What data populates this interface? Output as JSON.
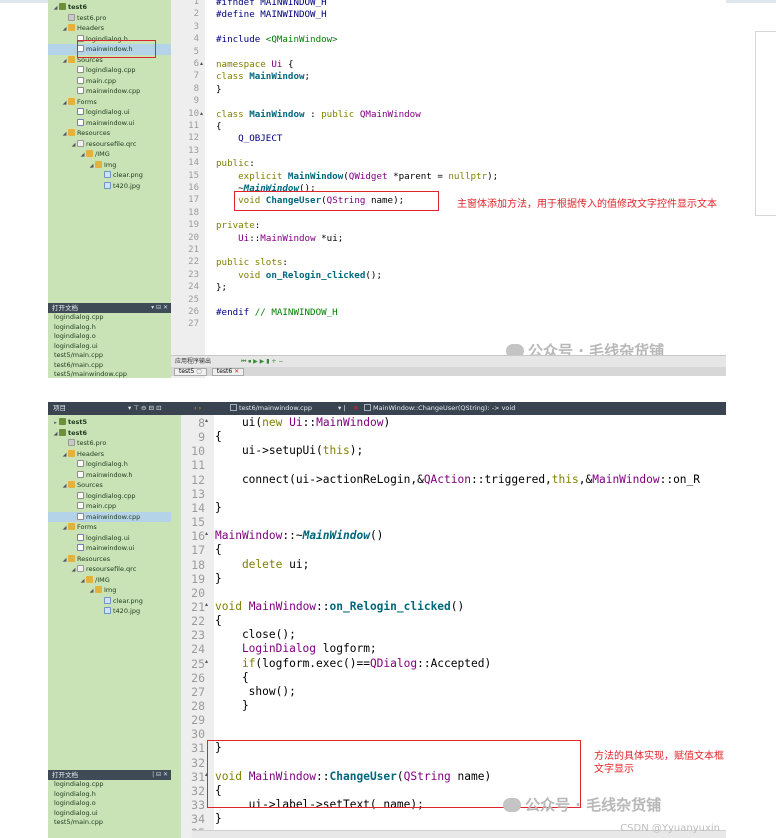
{
  "top": {
    "tree": [
      {
        "label": "test6",
        "indent": 0,
        "twisty": "◢",
        "icon": "proj",
        "selected": false,
        "bold": true
      },
      {
        "label": "test6.pro",
        "indent": 1,
        "twisty": "",
        "icon": "pro",
        "selected": false,
        "bold": false
      },
      {
        "label": "Headers",
        "indent": 1,
        "twisty": "◢",
        "icon": "folder",
        "selected": false,
        "bold": false
      },
      {
        "label": "logindialog.h",
        "indent": 2,
        "twisty": "",
        "icon": "file",
        "selected": false,
        "bold": false
      },
      {
        "label": "mainwindow.h",
        "indent": 2,
        "twisty": "",
        "icon": "file",
        "selected": true,
        "bold": false
      },
      {
        "label": "Sources",
        "indent": 1,
        "twisty": "◢",
        "icon": "folder",
        "selected": false,
        "bold": false
      },
      {
        "label": "logindialog.cpp",
        "indent": 2,
        "twisty": "",
        "icon": "file",
        "selected": false,
        "bold": false
      },
      {
        "label": "main.cpp",
        "indent": 2,
        "twisty": "",
        "icon": "file",
        "selected": false,
        "bold": false
      },
      {
        "label": "mainwindow.cpp",
        "indent": 2,
        "twisty": "",
        "icon": "file",
        "selected": false,
        "bold": false
      },
      {
        "label": "Forms",
        "indent": 1,
        "twisty": "◢",
        "icon": "folder",
        "selected": false,
        "bold": false
      },
      {
        "label": "logindialog.ui",
        "indent": 2,
        "twisty": "",
        "icon": "ui",
        "selected": false,
        "bold": false
      },
      {
        "label": "mainwindow.ui",
        "indent": 2,
        "twisty": "",
        "icon": "ui",
        "selected": false,
        "bold": false
      },
      {
        "label": "Resources",
        "indent": 1,
        "twisty": "◢",
        "icon": "folder",
        "selected": false,
        "bold": false
      },
      {
        "label": "resoursefile.qrc",
        "indent": 2,
        "twisty": "◢",
        "icon": "qrc",
        "selected": false,
        "bold": false
      },
      {
        "label": "/IMG",
        "indent": 3,
        "twisty": "◢",
        "icon": "folder",
        "selected": false,
        "bold": false
      },
      {
        "label": "Img",
        "indent": 4,
        "twisty": "◢",
        "icon": "folder",
        "selected": false,
        "bold": false
      },
      {
        "label": "clear.png",
        "indent": 5,
        "twisty": "",
        "icon": "img",
        "selected": false,
        "bold": false
      },
      {
        "label": "t420.jpg",
        "indent": 5,
        "twisty": "",
        "icon": "img",
        "selected": false,
        "bold": false
      }
    ],
    "open_docs_title": "打开文档",
    "open_docs": [
      "logindialog.cpp",
      "logindialog.h",
      "logindialog.o",
      "logindialog.ui",
      "test5/main.cpp",
      "test6/main.cpp",
      "test5/mainwindow.cpp"
    ],
    "code": [
      {
        "n": "1",
        "fold": "",
        "parts": [
          [
            "c-pp",
            "#ifndef MAINWINDOW_H"
          ]
        ]
      },
      {
        "n": "2",
        "fold": "",
        "parts": [
          [
            "c-pp",
            "#define MAINWINDOW_H"
          ]
        ]
      },
      {
        "n": "3",
        "fold": "",
        "parts": []
      },
      {
        "n": "4",
        "fold": "",
        "parts": [
          [
            "c-pp",
            "#include "
          ],
          [
            "c-str",
            "<QMainWindow>"
          ]
        ]
      },
      {
        "n": "5",
        "fold": "",
        "parts": []
      },
      {
        "n": "6",
        "fold": "▴",
        "parts": [
          [
            "c-kw",
            "namespace "
          ],
          [
            "c-type",
            "Ui"
          ],
          [
            "c-def",
            " {"
          ]
        ]
      },
      {
        "n": "7",
        "fold": "",
        "parts": [
          [
            "c-kw",
            "class "
          ],
          [
            "c-fn",
            "MainWindow"
          ],
          [
            "c-def",
            ";"
          ]
        ]
      },
      {
        "n": "8",
        "fold": "",
        "parts": [
          [
            "c-def",
            "}"
          ]
        ]
      },
      {
        "n": "9",
        "fold": "",
        "parts": []
      },
      {
        "n": "10",
        "fold": "▴",
        "parts": [
          [
            "c-kw",
            "class "
          ],
          [
            "c-fn",
            "MainWindow"
          ],
          [
            "c-def",
            " : "
          ],
          [
            "c-kw",
            "public "
          ],
          [
            "c-type",
            "QMainWindow"
          ]
        ]
      },
      {
        "n": "11",
        "fold": "",
        "parts": [
          [
            "c-def",
            "{"
          ]
        ]
      },
      {
        "n": "12",
        "fold": "",
        "parts": [
          [
            "c-pp",
            "    Q_OBJECT"
          ]
        ]
      },
      {
        "n": "13",
        "fold": "",
        "parts": []
      },
      {
        "n": "14",
        "fold": "",
        "parts": [
          [
            "c-kw",
            "public"
          ],
          [
            "c-def",
            ":"
          ]
        ]
      },
      {
        "n": "15",
        "fold": "",
        "parts": [
          [
            "c-kw",
            "    explicit "
          ],
          [
            "c-fn",
            "MainWindow"
          ],
          [
            "c-def",
            "("
          ],
          [
            "c-type",
            "QWidget"
          ],
          [
            "c-def",
            " *parent = "
          ],
          [
            "c-kw",
            "nullptr"
          ],
          [
            "c-def",
            ");"
          ]
        ]
      },
      {
        "n": "16",
        "fold": "",
        "parts": [
          [
            "c-def",
            "    ~"
          ],
          [
            "c-fni",
            "MainWindow"
          ],
          [
            "c-def",
            "();"
          ]
        ]
      },
      {
        "n": "17",
        "fold": "",
        "parts": [
          [
            "c-kw",
            "    void "
          ],
          [
            "c-fn",
            "ChangeUser"
          ],
          [
            "c-def",
            "("
          ],
          [
            "c-type",
            "QString"
          ],
          [
            "c-def",
            " name);"
          ]
        ]
      },
      {
        "n": "18",
        "fold": "",
        "parts": []
      },
      {
        "n": "19",
        "fold": "",
        "parts": [
          [
            "c-kw",
            "private"
          ],
          [
            "c-def",
            ":"
          ]
        ]
      },
      {
        "n": "20",
        "fold": "",
        "parts": [
          [
            "c-type",
            "    Ui"
          ],
          [
            "c-def",
            "::"
          ],
          [
            "c-type",
            "MainWindow"
          ],
          [
            "c-def",
            " *ui;"
          ]
        ]
      },
      {
        "n": "21",
        "fold": "",
        "parts": []
      },
      {
        "n": "22",
        "fold": "",
        "parts": [
          [
            "c-kw",
            "public slots"
          ],
          [
            "c-def",
            ":"
          ]
        ]
      },
      {
        "n": "23",
        "fold": "",
        "parts": [
          [
            "c-kw",
            "    void "
          ],
          [
            "c-fn",
            "on_Relogin_clicked"
          ],
          [
            "c-def",
            "();"
          ]
        ]
      },
      {
        "n": "24",
        "fold": "",
        "parts": [
          [
            "c-def",
            "};"
          ]
        ]
      },
      {
        "n": "25",
        "fold": "",
        "parts": []
      },
      {
        "n": "26",
        "fold": "",
        "parts": [
          [
            "c-pp",
            "#endif "
          ],
          [
            "c-str",
            "// MAINWINDOW_H"
          ]
        ]
      },
      {
        "n": "27",
        "fold": "",
        "parts": []
      }
    ],
    "annotation": "主窗体添加方法，用于根据传入的值修改文字控件显示文本",
    "watermark": "公众号 · 毛线杂货铺",
    "bottom_bar": "应用程序输出",
    "bottom_controls": "⏮ ⏹ ▶ ▶ ▮ + −",
    "tabs": [
      "test5",
      "test6"
    ]
  },
  "bottom": {
    "toolbar": {
      "project_label": "项目",
      "file_path": "test6/mainwindow.cpp",
      "function_label": "MainWindow::ChangeUser(QString): -> void"
    },
    "tree": [
      {
        "label": "test5",
        "indent": 0,
        "twisty": "▸",
        "icon": "proj",
        "selected": false,
        "bold": true
      },
      {
        "label": "test6",
        "indent": 0,
        "twisty": "◢",
        "icon": "proj",
        "selected": false,
        "bold": true
      },
      {
        "label": "test6.pro",
        "indent": 1,
        "twisty": "",
        "icon": "pro",
        "selected": false,
        "bold": false
      },
      {
        "label": "Headers",
        "indent": 1,
        "twisty": "◢",
        "icon": "folder",
        "selected": false,
        "bold": false
      },
      {
        "label": "logindialog.h",
        "indent": 2,
        "twisty": "",
        "icon": "file",
        "selected": false,
        "bold": false
      },
      {
        "label": "mainwindow.h",
        "indent": 2,
        "twisty": "",
        "icon": "file",
        "selected": false,
        "bold": false
      },
      {
        "label": "Sources",
        "indent": 1,
        "twisty": "◢",
        "icon": "folder",
        "selected": false,
        "bold": false
      },
      {
        "label": "logindialog.cpp",
        "indent": 2,
        "twisty": "",
        "icon": "file",
        "selected": false,
        "bold": false
      },
      {
        "label": "main.cpp",
        "indent": 2,
        "twisty": "",
        "icon": "file",
        "selected": false,
        "bold": false
      },
      {
        "label": "mainwindow.cpp",
        "indent": 2,
        "twisty": "",
        "icon": "file",
        "selected": true,
        "bold": false
      },
      {
        "label": "Forms",
        "indent": 1,
        "twisty": "◢",
        "icon": "folder",
        "selected": false,
        "bold": false
      },
      {
        "label": "logindialog.ui",
        "indent": 2,
        "twisty": "",
        "icon": "ui",
        "selected": false,
        "bold": false
      },
      {
        "label": "mainwindow.ui",
        "indent": 2,
        "twisty": "",
        "icon": "ui",
        "selected": false,
        "bold": false
      },
      {
        "label": "Resources",
        "indent": 1,
        "twisty": "◢",
        "icon": "folder",
        "selected": false,
        "bold": false
      },
      {
        "label": "resoursefile.qrc",
        "indent": 2,
        "twisty": "◢",
        "icon": "qrc",
        "selected": false,
        "bold": false
      },
      {
        "label": "/IMG",
        "indent": 3,
        "twisty": "◢",
        "icon": "folder",
        "selected": false,
        "bold": false
      },
      {
        "label": "Img",
        "indent": 4,
        "twisty": "◢",
        "icon": "folder",
        "selected": false,
        "bold": false
      },
      {
        "label": "clear.png",
        "indent": 5,
        "twisty": "",
        "icon": "img",
        "selected": false,
        "bold": false
      },
      {
        "label": "t420.jpg",
        "indent": 5,
        "twisty": "",
        "icon": "img",
        "selected": false,
        "bold": false
      }
    ],
    "open_docs_title": "打开文档",
    "open_docs": [
      "logindialog.cpp",
      "logindialog.h",
      "logindialog.o",
      "logindialog.ui",
      "test5/main.cpp"
    ],
    "code": [
      {
        "n": "8",
        "fold": "▴",
        "parts": [
          [
            "c-def",
            "    ui("
          ],
          [
            "c-kw",
            "new "
          ],
          [
            "c-type",
            "Ui"
          ],
          [
            "c-def",
            "::"
          ],
          [
            "c-type",
            "MainWindow"
          ],
          [
            "c-def",
            ")"
          ]
        ]
      },
      {
        "n": "9",
        "fold": "",
        "parts": [
          [
            "c-def",
            "{"
          ]
        ]
      },
      {
        "n": "10",
        "fold": "",
        "parts": [
          [
            "c-def",
            "    ui->setupUi("
          ],
          [
            "c-kw",
            "this"
          ],
          [
            "c-def",
            ");"
          ]
        ]
      },
      {
        "n": "11",
        "fold": "",
        "parts": []
      },
      {
        "n": "12",
        "fold": "",
        "parts": [
          [
            "c-def",
            "    connect(ui->actionReLogin,&"
          ],
          [
            "c-type",
            "QAction"
          ],
          [
            "c-def",
            "::triggered,"
          ],
          [
            "c-kw",
            "this"
          ],
          [
            "c-def",
            ",&"
          ],
          [
            "c-type",
            "MainWindow"
          ],
          [
            "c-def",
            "::on_R"
          ]
        ]
      },
      {
        "n": "13",
        "fold": "",
        "parts": []
      },
      {
        "n": "14",
        "fold": "",
        "parts": [
          [
            "c-def",
            "}"
          ]
        ]
      },
      {
        "n": "15",
        "fold": "",
        "parts": []
      },
      {
        "n": "16",
        "fold": "▴",
        "parts": [
          [
            "c-type",
            "MainWindow"
          ],
          [
            "c-def",
            "::~"
          ],
          [
            "c-fni",
            "MainWindow"
          ],
          [
            "c-def",
            "()"
          ]
        ]
      },
      {
        "n": "17",
        "fold": "",
        "parts": [
          [
            "c-def",
            "{"
          ]
        ]
      },
      {
        "n": "18",
        "fold": "",
        "parts": [
          [
            "c-kw",
            "    delete "
          ],
          [
            "c-def",
            "ui;"
          ]
        ]
      },
      {
        "n": "19",
        "fold": "",
        "parts": [
          [
            "c-def",
            "}"
          ]
        ]
      },
      {
        "n": "20",
        "fold": "",
        "parts": []
      },
      {
        "n": "21",
        "fold": "▴",
        "parts": [
          [
            "c-kw",
            "void "
          ],
          [
            "c-type",
            "MainWindow"
          ],
          [
            "c-def",
            "::"
          ],
          [
            "c-fn",
            "on_Relogin_clicked"
          ],
          [
            "c-def",
            "()"
          ]
        ]
      },
      {
        "n": "22",
        "fold": "",
        "parts": [
          [
            "c-def",
            "{"
          ]
        ]
      },
      {
        "n": "23",
        "fold": "",
        "parts": [
          [
            "c-def",
            "    close();"
          ]
        ]
      },
      {
        "n": "24",
        "fold": "",
        "parts": [
          [
            "c-type",
            "    LoginDialog"
          ],
          [
            "c-def",
            " logform;"
          ]
        ]
      },
      {
        "n": "25",
        "fold": "▴",
        "parts": [
          [
            "c-kw",
            "    if"
          ],
          [
            "c-def",
            "(logform.exec()=="
          ],
          [
            "c-type",
            "QDialog"
          ],
          [
            "c-def",
            "::Accepted)"
          ]
        ]
      },
      {
        "n": "26",
        "fold": "",
        "parts": [
          [
            "c-def",
            "    {"
          ]
        ]
      },
      {
        "n": "27",
        "fold": "",
        "parts": [
          [
            "c-def",
            "     show();"
          ]
        ]
      },
      {
        "n": "28",
        "fold": "",
        "parts": [
          [
            "c-def",
            "    }"
          ]
        ]
      },
      {
        "n": "29",
        "fold": "",
        "parts": []
      },
      {
        "n": "30",
        "fold": "",
        "parts": []
      },
      {
        "n": "31",
        "fold": "",
        "parts": [
          [
            "c-def",
            "}"
          ]
        ]
      },
      {
        "n": "32",
        "fold": "",
        "parts": []
      },
      {
        "n": "31",
        "fold": "▴",
        "parts": [
          [
            "c-kw",
            "void "
          ],
          [
            "c-type",
            "MainWindow"
          ],
          [
            "c-def",
            "::"
          ],
          [
            "c-fn",
            "ChangeUser"
          ],
          [
            "c-def",
            "("
          ],
          [
            "c-type",
            "QString"
          ],
          [
            "c-def",
            " name)"
          ]
        ]
      },
      {
        "n": "32",
        "fold": "",
        "parts": [
          [
            "c-def",
            "{"
          ]
        ]
      },
      {
        "n": "33",
        "fold": "",
        "parts": [
          [
            "c-def",
            "     ui->label->setText( name);"
          ]
        ]
      },
      {
        "n": "34",
        "fold": "",
        "parts": [
          [
            "c-def",
            "}"
          ]
        ]
      },
      {
        "n": "35",
        "fold": "",
        "parts": []
      }
    ],
    "annotation": "方法的具体实现，赋值文本框文字显示",
    "watermark": "公众号 · 毛线杂货铺",
    "credit": "CSDN @Yyuanyuxin"
  }
}
